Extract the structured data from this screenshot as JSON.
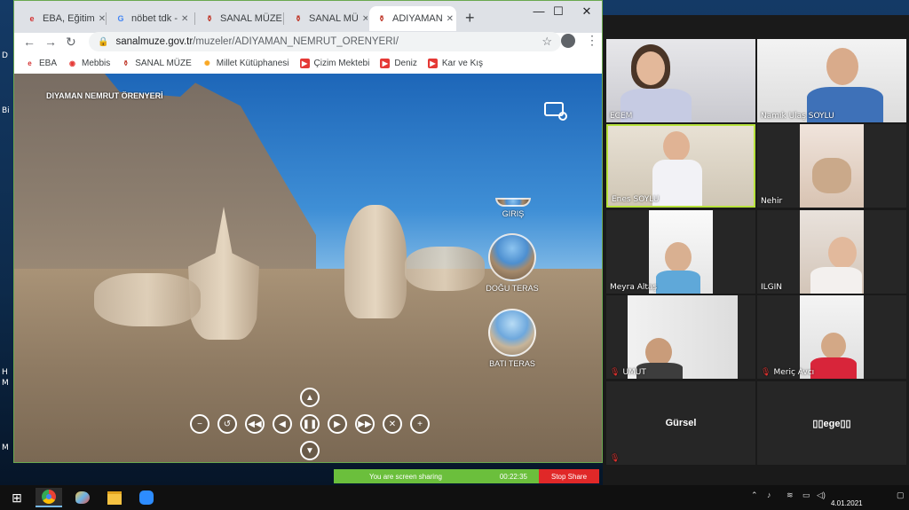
{
  "browser": {
    "tabs": [
      {
        "label": "EBA, Eğitim",
        "favicon": "eba-icon",
        "color": "#d32f2f"
      },
      {
        "label": "nöbet tdk -",
        "favicon": "google-icon",
        "color": "#4285f4"
      },
      {
        "label": "SANAL MÜZE",
        "favicon": "museum-icon",
        "color": "#c0392b"
      },
      {
        "label": "SANAL MÜ",
        "favicon": "museum-icon",
        "color": "#c0392b"
      },
      {
        "label": "ADIYAMAN",
        "favicon": "museum-icon",
        "color": "#c0392b",
        "active": true
      }
    ],
    "url_host": "sanalmuze.gov.tr",
    "url_path": "/muzeler/ADIYAMAN_NEMRUT_ORENYERI/",
    "bookmarks": [
      {
        "label": "EBA",
        "icon": "eba-icon"
      },
      {
        "label": "Mebbis",
        "icon": "mebbis-icon"
      },
      {
        "label": "SANAL MÜZE",
        "icon": "museum-icon"
      },
      {
        "label": "Millet Kütüphanesi",
        "icon": "library-icon"
      },
      {
        "label": "Çizim Mektebi",
        "icon": "youtube-icon"
      },
      {
        "label": "Deniz",
        "icon": "youtube-icon"
      },
      {
        "label": "Kar ve Kış",
        "icon": "youtube-icon"
      }
    ]
  },
  "pano": {
    "title": "DIYAMAN NEMRUT ÖRENYERİ",
    "pois": [
      "GIRIŞ",
      "DOĞU TERAS",
      "BATI TERAS"
    ]
  },
  "zoom": {
    "participants": [
      {
        "name": "ECEM",
        "muted": false,
        "video": true
      },
      {
        "name": "Namık Ulaş SOYLU",
        "muted": false,
        "video": true
      },
      {
        "name": "Enes SOYLU",
        "muted": false,
        "video": true,
        "speaking": true
      },
      {
        "name": "Nehir",
        "muted": false,
        "video": true
      },
      {
        "name": "Meyra Altaş",
        "muted": false,
        "video": true
      },
      {
        "name": "ILGIN",
        "muted": false,
        "video": true
      },
      {
        "name": "UMUT",
        "muted": true,
        "video": true
      },
      {
        "name": "Meriç Avcı",
        "muted": true,
        "video": true
      },
      {
        "name": "Gürsel",
        "muted": true,
        "video": false
      },
      {
        "name": "▯▯ege▯▯",
        "muted": false,
        "video": false
      }
    ]
  },
  "share": {
    "status": "You are screen sharing",
    "timer": "00:22:35",
    "stop_label": "Stop Share"
  },
  "taskbar": {
    "date": "4.01.2021",
    "apps": [
      "chrome-icon",
      "paint-icon",
      "file-explorer-icon",
      "zoom-icon"
    ]
  }
}
